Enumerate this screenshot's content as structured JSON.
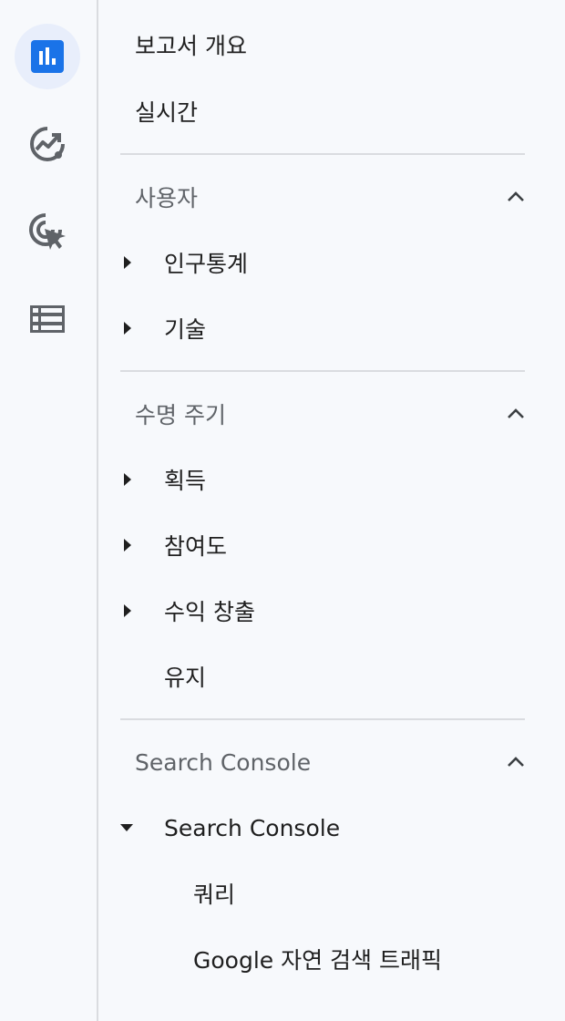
{
  "rail": {
    "items": [
      {
        "icon": "bar-chart-icon",
        "active": true
      },
      {
        "icon": "insights-trend-icon",
        "active": false
      },
      {
        "icon": "cursor-target-icon",
        "active": false
      },
      {
        "icon": "table-list-icon",
        "active": false
      }
    ],
    "accent_color": "#1a73e8",
    "icon_color": "#5f6368"
  },
  "nav": {
    "report_overview": "보고서 개요",
    "realtime": "실시간",
    "sections": [
      {
        "title": "사용자",
        "items": [
          "인구통계",
          "기술"
        ]
      },
      {
        "title": "수명 주기",
        "items": [
          "획득",
          "참여도",
          "수익 창출",
          "유지"
        ]
      },
      {
        "title": "Search Console",
        "items": [
          "Search Console"
        ],
        "sub_items": [
          "쿼리",
          "Google 자연 검색 트래픽"
        ]
      }
    ]
  }
}
